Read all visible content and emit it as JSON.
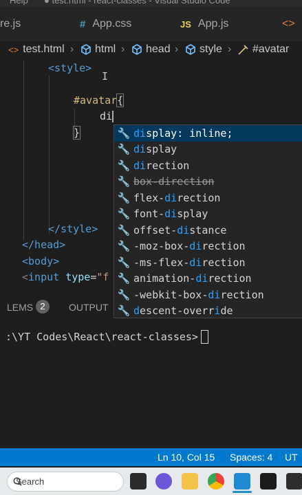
{
  "window": {
    "menu_fragment": "Help",
    "title": "● test.html - react-classes - Visual Studio Code"
  },
  "tabs": [
    {
      "label": "re.js",
      "icon": "js-file-icon"
    },
    {
      "label": "App.css",
      "icon": "css-file-icon",
      "icon_glyph": "#"
    },
    {
      "label": "App.js",
      "icon": "js-file-icon",
      "icon_glyph": "JS"
    }
  ],
  "breadcrumb": [
    "test.html",
    "html",
    "head",
    "style",
    "#avatar"
  ],
  "editor": {
    "lines": {
      "style_open": "<style>",
      "selector": "#avatar",
      "brace_open": "{",
      "typed": "di",
      "brace_close": "}",
      "style_close": "</style>",
      "head_close": "</head>",
      "body_open": "<body>",
      "input_tag": "input",
      "input_attr": "type",
      "input_eq": "=",
      "input_val": "\"f"
    }
  },
  "suggestions": [
    {
      "pre": "",
      "match": "di",
      "post": "splay: inline;"
    },
    {
      "pre": "",
      "match": "di",
      "post": "splay"
    },
    {
      "pre": "",
      "match": "di",
      "post": "rection"
    },
    {
      "pre": "box-",
      "match": "di",
      "post": "rection",
      "deprecated": true
    },
    {
      "pre": "flex-",
      "match": "di",
      "post": "rection"
    },
    {
      "pre": "font-",
      "match": "di",
      "post": "splay"
    },
    {
      "pre": "offset-",
      "match": "di",
      "post": "stance"
    },
    {
      "pre": "-moz-box-",
      "match": "di",
      "post": "rection"
    },
    {
      "pre": "-ms-flex-",
      "match": "di",
      "post": "rection"
    },
    {
      "pre": "animation-",
      "match": "di",
      "post": "rection"
    },
    {
      "pre": "-webkit-box-",
      "match": "di",
      "post": "rection"
    },
    {
      "pre": "",
      "match": "d",
      "post": "escent-overr",
      "match2": "i",
      "post2": "de"
    }
  ],
  "panel": {
    "problems_label": "LEMS",
    "problems_count": "2",
    "output_label": "OUTPUT"
  },
  "terminal": {
    "prompt": ":\\YT Codes\\React\\react-classes>",
    "cursor": " "
  },
  "statusbar": {
    "position": "Ln 10, Col 15",
    "spaces": "Spaces: 4",
    "encoding": "UT"
  },
  "taskbar": {
    "search_placeholder": "Search"
  },
  "colors": {
    "accent": "#007acc",
    "match": "#2aa1ff",
    "selection": "#04395e"
  }
}
